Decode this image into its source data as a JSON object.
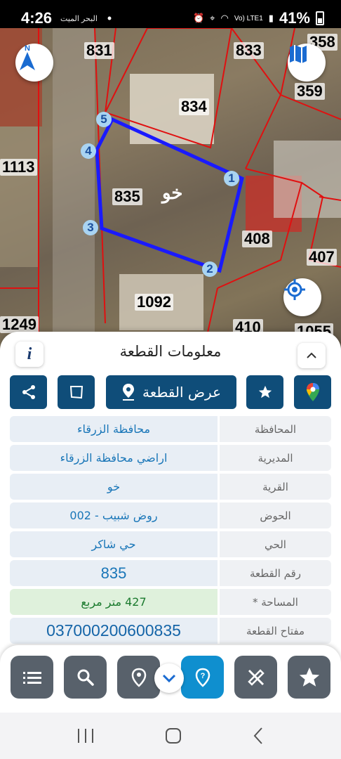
{
  "status_bar": {
    "time": "4:26",
    "notification_text": "البحر الميت",
    "battery": "41%",
    "network": "Vo) LTE1"
  },
  "map": {
    "parcel_numbers": [
      "831",
      "833",
      "358",
      "359",
      "834",
      "1113",
      "835",
      "408",
      "407",
      "1092",
      "1249",
      "410",
      "1055"
    ],
    "village_label": "خو",
    "vertices": [
      "1",
      "2",
      "3",
      "4",
      "5"
    ],
    "compass_label": "N"
  },
  "sheet": {
    "title": "معلومات القطعة",
    "show_parcel_button": "عرض القطعة",
    "rows": [
      {
        "label": "المحافظة",
        "value": "محافظة الزرقاء"
      },
      {
        "label": "المديرية",
        "value": "اراضي محافظة الزرقاء"
      },
      {
        "label": "القرية",
        "value": "خو"
      },
      {
        "label": "الحوض",
        "value": "روض شبيب - 002"
      },
      {
        "label": "الحي",
        "value": "حي شاكر"
      },
      {
        "label": "رقم القطعة",
        "value": "835"
      },
      {
        "label": "المساحة *",
        "value": "427 متر مربع"
      },
      {
        "label": "مفتاح القطعة",
        "value": "037000200600835"
      }
    ]
  },
  "colors": {
    "primary": "#0f4d79",
    "active": "#0f8fcf",
    "toolbar_button": "#58616b",
    "parcel_outline": "#1a1aff",
    "boundary": "#e01010"
  }
}
